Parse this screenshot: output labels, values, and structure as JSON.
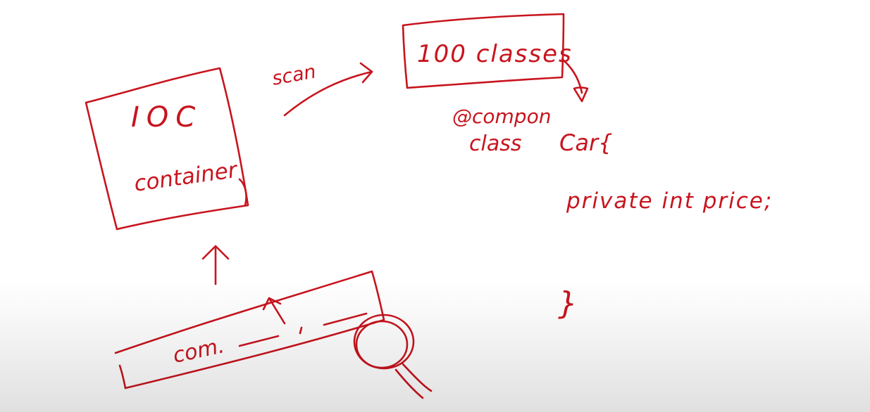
{
  "ink_color": "#c8141e",
  "background_color": "#ffffff",
  "ioc_box": {
    "line1": "IOC",
    "line2": "container"
  },
  "scan_arrow": {
    "label": "scan"
  },
  "classes_box": {
    "label": "100 classes"
  },
  "component_note": {
    "line1": "@compon",
    "line2": "class",
    "class_name": "Car{"
  },
  "class_body": {
    "field": "private int price;",
    "closing_brace": "}"
  },
  "package_bar": {
    "label": "com."
  },
  "magnifier": {
    "icon": "magnifying-glass-icon"
  }
}
